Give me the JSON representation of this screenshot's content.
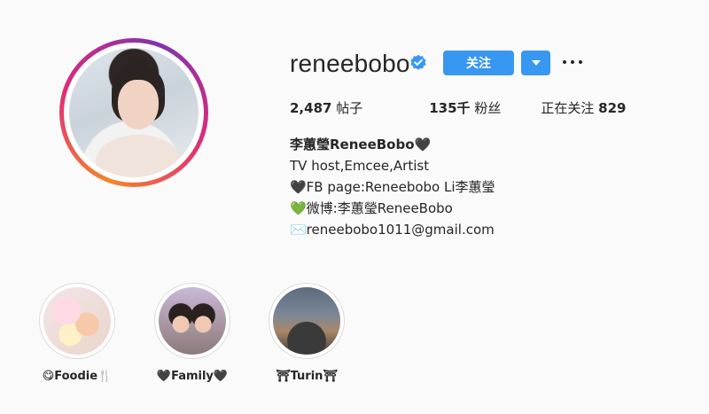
{
  "profile": {
    "username": "reneebobo",
    "verified": true,
    "follow_label": "关注",
    "accent_color": "#3897f0"
  },
  "stats": {
    "posts_count": "2,487",
    "posts_label": "帖子",
    "followers_count": "135千",
    "followers_label": "粉丝",
    "following_label": "正在关注",
    "following_count": "829"
  },
  "bio": {
    "name": "李蕙瑩ReneeBobo🖤",
    "lines": [
      "  TV host,Emcee,Artist",
      "🖤FB page:Reneebobo Li李蕙瑩",
      "💚微博:李蕙瑩ReneeBobo",
      "✉️reneebobo1011@gmail.com"
    ]
  },
  "highlights": [
    {
      "label": "😋Foodie🍴",
      "icon": "foodie-thumbnail"
    },
    {
      "label": "🖤Family🖤",
      "icon": "family-thumbnail"
    },
    {
      "label": "⛩Turin⛩",
      "icon": "turin-thumbnail"
    }
  ]
}
